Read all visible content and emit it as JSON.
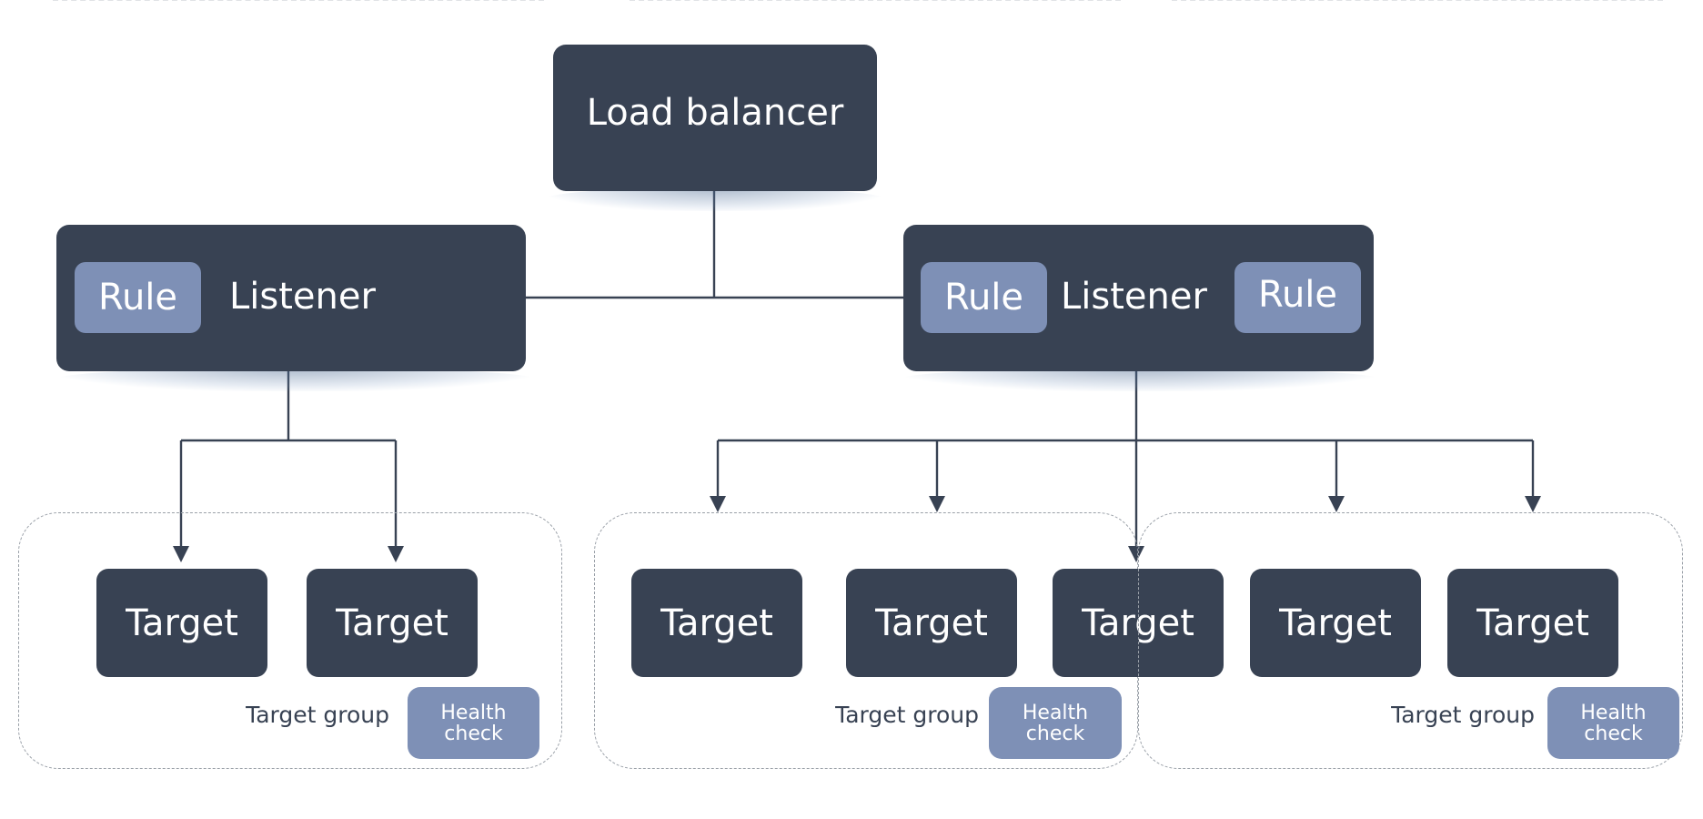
{
  "colors": {
    "node_dark": "#384253",
    "chip_blue": "#7e90b6",
    "line": "#384253",
    "group_border": "#9aa0a8"
  },
  "load_balancer": {
    "label": "Load balancer"
  },
  "listeners": [
    {
      "label": "Listener",
      "rules": [
        "Rule"
      ]
    },
    {
      "label": "Listener",
      "rules": [
        "Rule",
        "Rule"
      ]
    }
  ],
  "target_groups": [
    {
      "label": "Target group",
      "health_check": "Health check",
      "targets": [
        "Target",
        "Target"
      ]
    },
    {
      "label": "Target group",
      "health_check": "Health check",
      "targets": [
        "Target",
        "Target",
        "Target"
      ]
    },
    {
      "label": "Target group",
      "health_check": "Health check",
      "targets": [
        "Target",
        "Target"
      ]
    }
  ]
}
